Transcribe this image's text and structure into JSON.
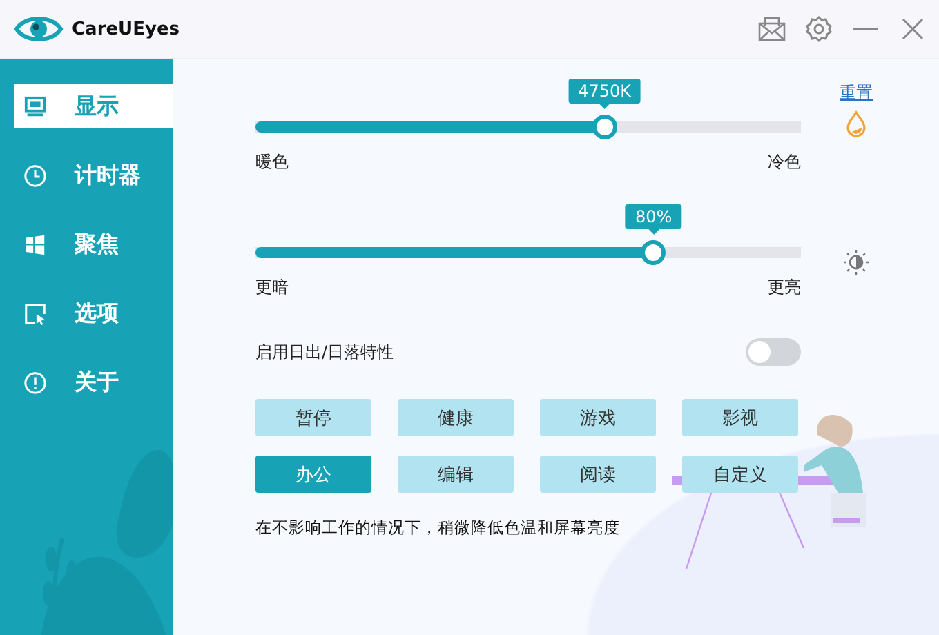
{
  "window": {
    "title": "CareUEyes"
  },
  "sidebar": {
    "items": [
      {
        "kind": "display",
        "label": "显示",
        "selected": true
      },
      {
        "kind": "timer",
        "label": "计时器",
        "selected": false
      },
      {
        "kind": "focus",
        "label": "聚焦",
        "selected": false
      },
      {
        "kind": "options",
        "label": "选项",
        "selected": false
      },
      {
        "kind": "about",
        "label": "关于",
        "selected": false
      }
    ]
  },
  "sliders": [
    {
      "kind": "temperature",
      "reading": "4750K",
      "level": 0.64,
      "min_label": "暖色",
      "max_label": "冷色",
      "link": "重置"
    },
    {
      "kind": "brightness",
      "reading": "80%",
      "level": 0.73,
      "min_label": "更暗",
      "max_label": "更亮"
    }
  ],
  "toggle": {
    "label": "启用日出/日落特性",
    "on": false
  },
  "presets": [
    {
      "label": "暂停",
      "selected": false
    },
    {
      "label": "健康",
      "selected": false
    },
    {
      "label": "游戏",
      "selected": false
    },
    {
      "label": "影视",
      "selected": false
    },
    {
      "label": "办公",
      "selected": true
    },
    {
      "label": "编辑",
      "selected": false
    },
    {
      "label": "阅读",
      "selected": false
    },
    {
      "label": "自定义",
      "selected": false
    }
  ],
  "description": "在不影响工作的情况下，稍微降低色温和屏幕亮度"
}
